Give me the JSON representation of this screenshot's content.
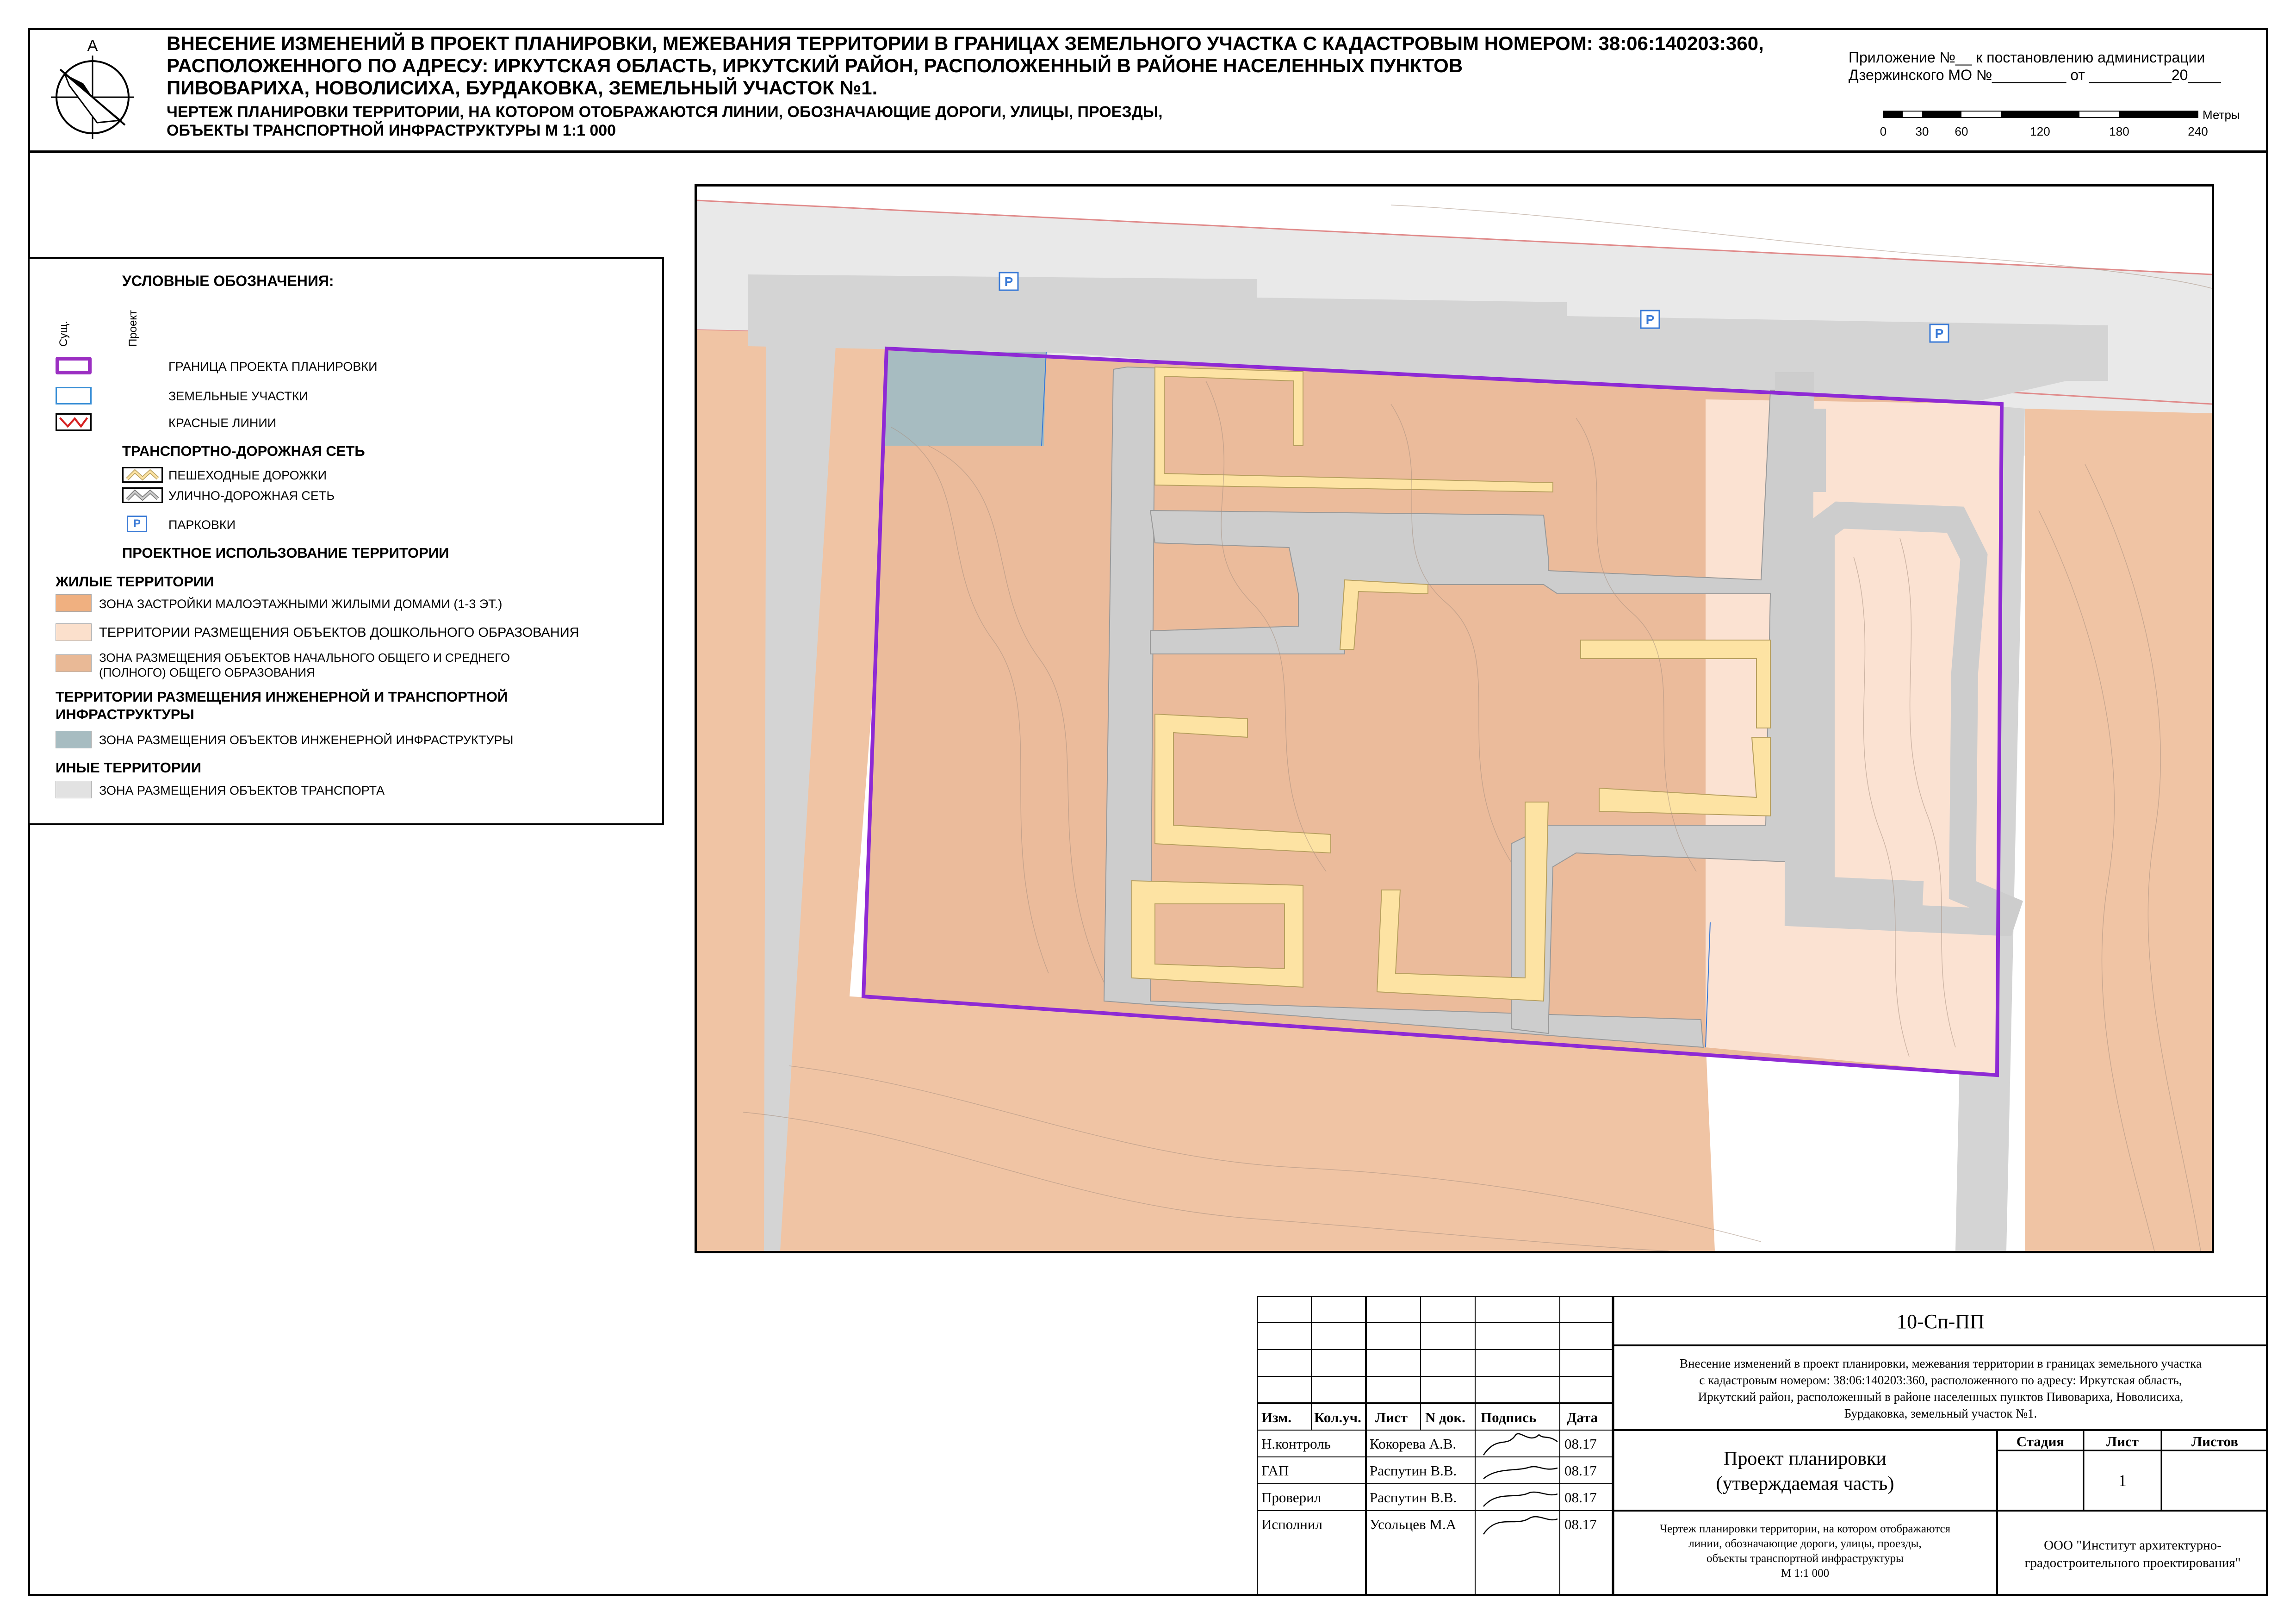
{
  "header": {
    "title_lines": [
      "ВНЕСЕНИЕ ИЗМЕНЕНИЙ В ПРОЕКТ ПЛАНИРОВКИ, МЕЖЕВАНИЯ ТЕРРИТОРИИ В ГРАНИЦАХ ЗЕМЕЛЬНОГО УЧАСТКА С КАДАСТРОВЫМ НОМЕРОМ: 38:06:140203:360,",
      "РАСПОЛОЖЕННОГО ПО АДРЕСУ: ИРКУТСКАЯ ОБЛАСТЬ, ИРКУТСКИЙ РАЙОН, РАСПОЛОЖЕННЫЙ В РАЙОНЕ НАСЕЛЕННЫХ ПУНКТОВ",
      "ПИВОВАРИХА, НОВОЛИСИХА, БУРДАКОВКА, ЗЕМЕЛЬНЫЙ УЧАСТОК №1."
    ],
    "subtitle_lines": [
      "ЧЕРТЕЖ ПЛАНИРОВКИ ТЕРРИТОРИИ, НА КОТОРОМ ОТОБРАЖАЮТСЯ ЛИНИИ, ОБОЗНАЧАЮЩИЕ ДОРОГИ, УЛИЦЫ, ПРОЕЗДЫ,",
      "ОБЪЕКТЫ ТРАНСПОРТНОЙ ИНФРАСТРУКТУРЫ М 1:1 000"
    ],
    "appendix_lines": [
      "Приложение №__ к постановлению администрации",
      "Дзержинского МО №_________ от __________20____"
    ]
  },
  "scale_bar": {
    "unit": "Метры",
    "ticks": [
      "0",
      "30",
      "60",
      "120",
      "180",
      "240"
    ]
  },
  "legend": {
    "title": "УСЛОВНЫЕ ОБОЗНАЧЕНИЯ:",
    "col_existing": "Сущ.",
    "col_project": "Проект",
    "items_top": [
      {
        "label": "ГРАНИЦА ПРОЕКТА ПЛАНИРОВКИ"
      },
      {
        "label": "ЗЕМЕЛЬНЫЕ УЧАСТКИ"
      },
      {
        "label": "КРАСНЫЕ ЛИНИИ"
      }
    ],
    "transport_heading": "ТРАНСПОРТНО-ДОРОЖНАЯ СЕТЬ",
    "transport_items": [
      {
        "label": "ПЕШЕХОДНЫЕ ДОРОЖКИ"
      },
      {
        "label": "УЛИЧНО-ДОРОЖНАЯ СЕТЬ"
      },
      {
        "label": "ПАРКОВКИ",
        "icon": "P"
      }
    ],
    "usage_heading": "ПРОЕКТНОЕ ИСПОЛЬЗОВАНИЕ ТЕРРИТОРИИ",
    "residential_heading": "ЖИЛЫЕ ТЕРРИТОРИИ",
    "residential_items": [
      {
        "label": "ЗОНА ЗАСТРОЙКИ МАЛОЭТАЖНЫМИ ЖИЛЫМИ ДОМАМИ (1-3 ЭТ.)",
        "color": "#f0b080"
      },
      {
        "label": "ТЕРРИТОРИИ РАЗМЕЩЕНИЯ ОБЪЕКТОВ ДОШКОЛЬНОГО ОБРАЗОВАНИЯ",
        "color": "#fbe0cc"
      },
      {
        "label_lines": [
          "ЗОНА  РАЗМЕЩЕНИЯ ОБЪЕКТОВ НАЧАЛЬНОГО ОБЩЕГО И СРЕДНЕГО",
          "(ПОЛНОГО) ОБЩЕГО ОБРАЗОВАНИЯ"
        ],
        "color": "#e9b996"
      }
    ],
    "infra_heading_lines": [
      "ТЕРРИТОРИИ РАЗМЕЩЕНИЯ ИНЖЕНЕРНОЙ И ТРАНСПОРТНОЙ",
      "ИНФРАСТРУКТУРЫ"
    ],
    "infra_items": [
      {
        "label": "ЗОНА РАЗМЕЩЕНИЯ ОБЪЕКТОВ ИНЖЕНЕРНОЙ ИНФРАСТРУКТУРЫ",
        "color": "#a7bcc1"
      }
    ],
    "other_heading": "ИНЫЕ ТЕРРИТОРИИ",
    "other_items": [
      {
        "label": "ЗОНА РАЗМЕЩЕНИЯ ОБЪЕКТОВ ТРАНСПОРТА",
        "color": "#e2e2e2"
      }
    ]
  },
  "map": {
    "parking_label": "P",
    "colors": {
      "residential": "#f0c4a4",
      "school": "#ebbb9b",
      "preschool": "#fbe2d2",
      "engineering": "#a7bcc1",
      "road": "#cdcdcd",
      "transport_zone": "#e2e2e2",
      "footpath": "#fde3a3",
      "boundary": "#8e2ad4",
      "red_line": "#e08a8a",
      "parcel": "#3a7ad6"
    }
  },
  "stamp": {
    "code": "10-Сп-ПП",
    "description_lines": [
      "Внесение изменений в проект планировки, межевания территории в границах земельного участка",
      "с кадастровым номером: 38:06:140203:360, расположенного по адресу: Иркутская область,",
      "Иркутский район, расположенный в районе населенных пунктов Пивовариха, Новолисиха,",
      "Бурдаковка, земельный участок №1."
    ],
    "columns": [
      "Изм.",
      "Кол.уч.",
      "Лист",
      "N док.",
      "Подпись",
      "Дата"
    ],
    "signatures": [
      {
        "role": "Н.контроль",
        "name": "Кокорева А.В.",
        "date": "08.17"
      },
      {
        "role": "ГАП",
        "name": "Распутин В.В.",
        "date": "08.17"
      },
      {
        "role": "Проверил",
        "name": "Распутин В.В.",
        "date": "08.17"
      },
      {
        "role": "Исполнил",
        "name": "Усольцев М.А",
        "date": "08.17"
      }
    ],
    "project_title_lines": [
      "Проект планировки",
      "(утверждаемая часть)"
    ],
    "stage_header": "Стадия",
    "sheet_header": "Лист",
    "sheets_header": "Листов",
    "sheet_number": "1",
    "drawing_lines": [
      "Чертеж планировки территории, на котором отображаются",
      "линии, обозначающие дороги, улицы, проезды,",
      "объекты транспортной инфраструктуры",
      "М 1:1 000"
    ],
    "org_lines": [
      "ООО \"Институт архитектурно-",
      "градостроительного проектирования\""
    ]
  }
}
